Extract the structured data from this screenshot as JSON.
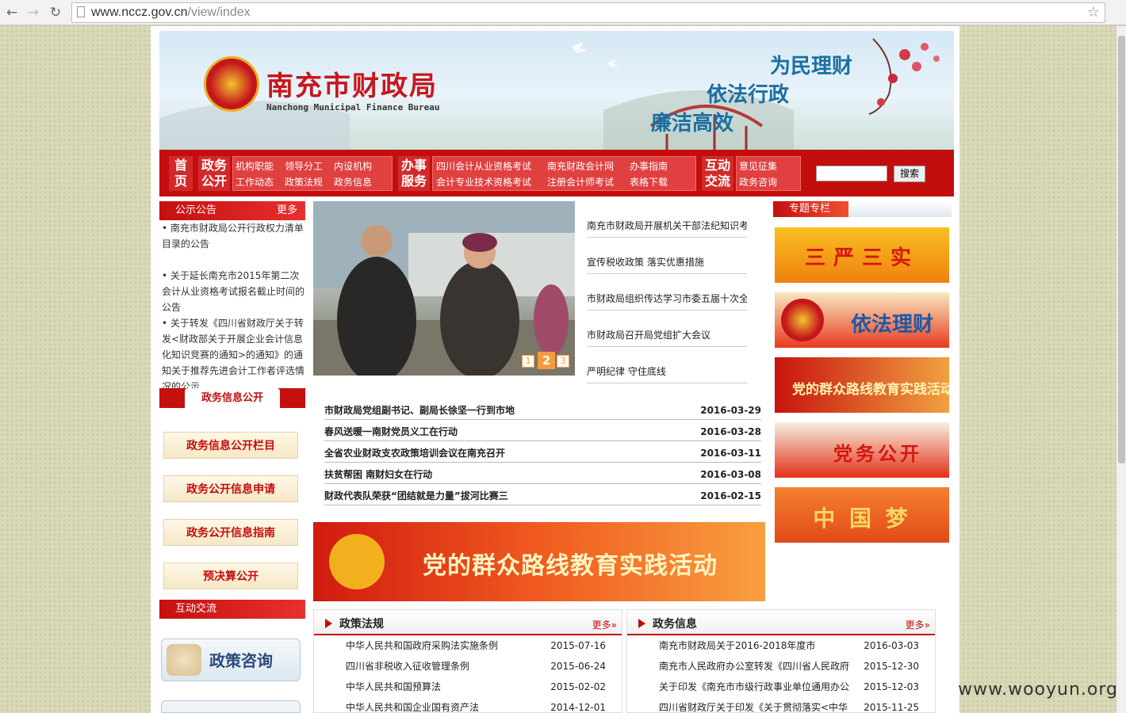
{
  "browser": {
    "url_domain": "www.nccz.gov.cn",
    "url_path": "/view/index"
  },
  "banner": {
    "title_cn": "南充市财政局",
    "title_en": "Nanchong Municipal Finance Bureau",
    "slogans": [
      "为民理财",
      "依法行政",
      "廉洁高效"
    ]
  },
  "nav": {
    "home": [
      "首",
      "页"
    ],
    "gov_open_title": [
      "政务",
      "公开"
    ],
    "gov_open_links": [
      "机构职能",
      "领导分工",
      "内设机构",
      "工作动态",
      "政策法规",
      "政务信息"
    ],
    "service_title": [
      "办事",
      "服务"
    ],
    "service_links": [
      "四川会计从业资格考试",
      "南充财政会计网",
      "办事指南",
      "会计专业技术资格考试",
      "注册会计师考试",
      "表格下载"
    ],
    "interact_title": [
      "互动",
      "交流"
    ],
    "interact_links": [
      "意见征集",
      "政务咨询"
    ],
    "search_button": "搜索"
  },
  "notice": {
    "title": "公示公告",
    "more": "更多",
    "items": [
      "• 南充市财政局公开行政权力清单目录的公告",
      "• 关于延长南充市2015年第二次会计从业资格考试报名截止时间的公告",
      "• 关于转发《四川省财政厅关于转发<财政部关于开展企业会计信息化知识竞赛的通知>的通知》的通知关于推荐先进会计工作者评选情况的公示"
    ]
  },
  "gov_info": {
    "title": "政务信息公开",
    "buttons": [
      "政务信息公开栏目",
      "政务公开信息申请",
      "政务公开信息指南",
      "预决算公开"
    ]
  },
  "interact": {
    "title": "互动交流",
    "consult": "政策咨询"
  },
  "slider": {
    "pages": [
      "1",
      "2",
      "3"
    ],
    "active": "2"
  },
  "side_news": [
    "南充市财政局开展机关干部法纪知识考",
    "宣传税收政策 落实优惠措施",
    "市财政局组织传达学习市委五届十次全",
    "市财政局召开局党组扩大会议",
    "严明纪律 守住底线"
  ],
  "headlines": [
    {
      "title": "市财政局党组副书记、副局长徐坚一行到市地",
      "date": "2016-03-29"
    },
    {
      "title": "春风送暖一南财党员义工在行动",
      "date": "2016-03-28"
    },
    {
      "title": "全省农业财政支农政策培训会议在南充召开",
      "date": "2016-03-11"
    },
    {
      "title": "扶贫帮困 南财妇女在行动",
      "date": "2016-03-08"
    },
    {
      "title": "财政代表队荣获“团结就是力量”拔河比赛三",
      "date": "2016-02-15"
    }
  ],
  "wide_banner": "党的群众路线教育实践活动",
  "special": {
    "title": "专题专栏",
    "items": [
      "三严三实",
      "依法理财",
      "党的群众路线教育实践活动",
      "党务公开",
      "中 国 梦"
    ]
  },
  "policy": {
    "title": "政策法规",
    "more": "更多",
    "rows": [
      {
        "title": "中华人民共和国政府采购法实施条例",
        "date": "2015-07-16"
      },
      {
        "title": "四川省非税收入征收管理条例",
        "date": "2015-06-24"
      },
      {
        "title": "中华人民共和国预算法",
        "date": "2015-02-02"
      },
      {
        "title": "中华人民共和国企业国有资产法",
        "date": "2014-12-01"
      }
    ]
  },
  "govnews": {
    "title": "政务信息",
    "more": "更多",
    "rows": [
      {
        "title": "南充市财政局关于2016-2018年度市",
        "date": "2016-03-03"
      },
      {
        "title": "南充市人民政府办公室转发《四川省人民政府",
        "date": "2015-12-30"
      },
      {
        "title": "关于印发《南充市市级行政事业单位通用办公",
        "date": "2015-12-03"
      },
      {
        "title": "四川省财政厅关于印发《关于贯彻落实<中华",
        "date": "2015-11-25"
      }
    ]
  },
  "watermark": "www.wooyun.org",
  "colors": {
    "brand_red": "#c40d0d",
    "nav_block": "#e04040",
    "bg_pattern": "#d9d8b7"
  }
}
